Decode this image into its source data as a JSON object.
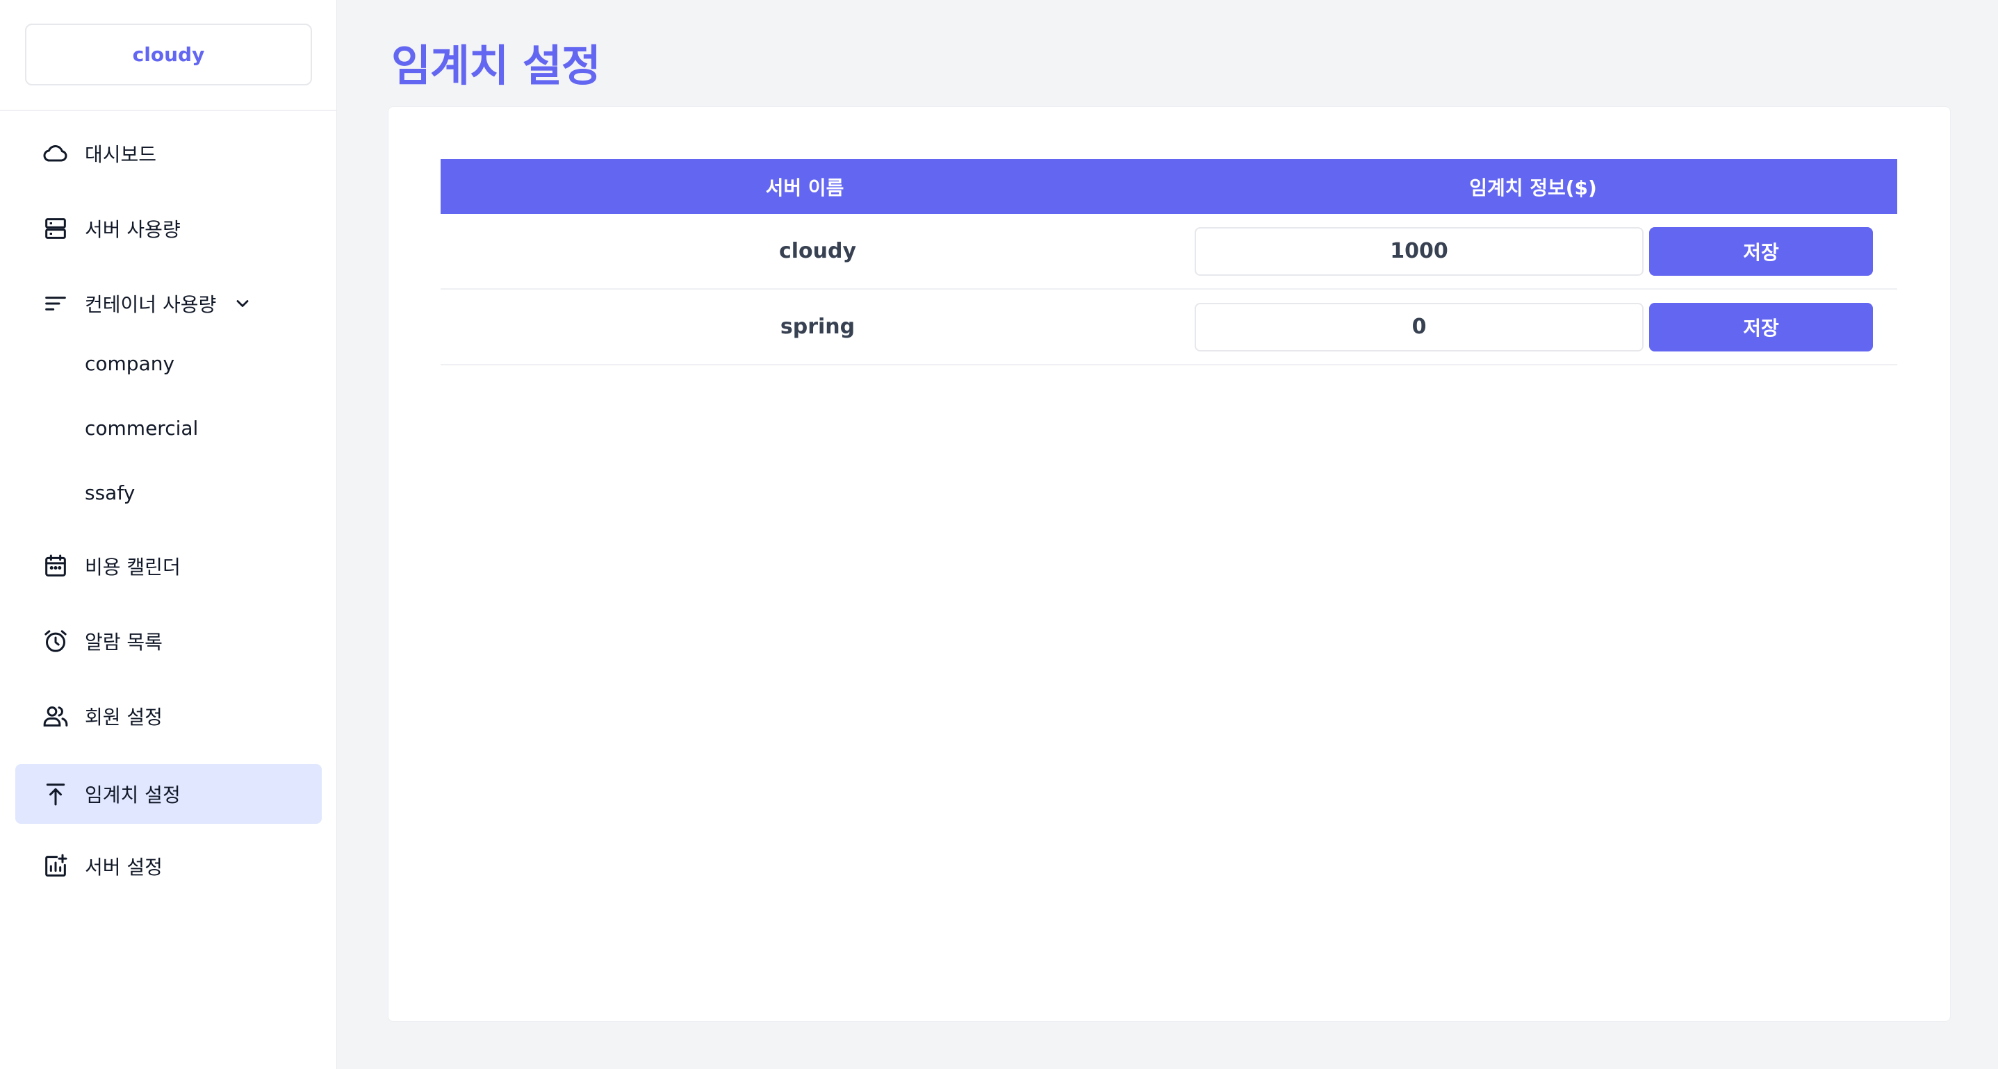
{
  "brand": "cloudy",
  "sidebar": {
    "items": [
      {
        "label": "대시보드",
        "icon": "cloud-icon"
      },
      {
        "label": "서버 사용량",
        "icon": "server-icon"
      },
      {
        "label": "컨테이너 사용량",
        "icon": "sort-lines-icon",
        "expanded": true,
        "children": [
          "company",
          "commercial",
          "ssafy"
        ]
      },
      {
        "label": "비용 캘린더",
        "icon": "calendar-icon"
      },
      {
        "label": "알람 목록",
        "icon": "alarm-clock-icon"
      },
      {
        "label": "회원 설정",
        "icon": "users-icon"
      },
      {
        "label": "임계치 설정",
        "icon": "upload-arrow-icon",
        "active": true
      },
      {
        "label": "서버 설정",
        "icon": "chart-plus-icon"
      }
    ]
  },
  "page": {
    "title": "임계치 설정"
  },
  "table": {
    "headers": {
      "name": "서버 이름",
      "threshold": "임계치 정보($)"
    },
    "rows": [
      {
        "name": "cloudy",
        "threshold": "1000",
        "save_label": "저장"
      },
      {
        "name": "spring",
        "threshold": "0",
        "save_label": "저장"
      }
    ]
  },
  "colors": {
    "accent": "#6366f1",
    "active_bg": "#e0e7ff",
    "page_bg": "#f3f4f6"
  }
}
